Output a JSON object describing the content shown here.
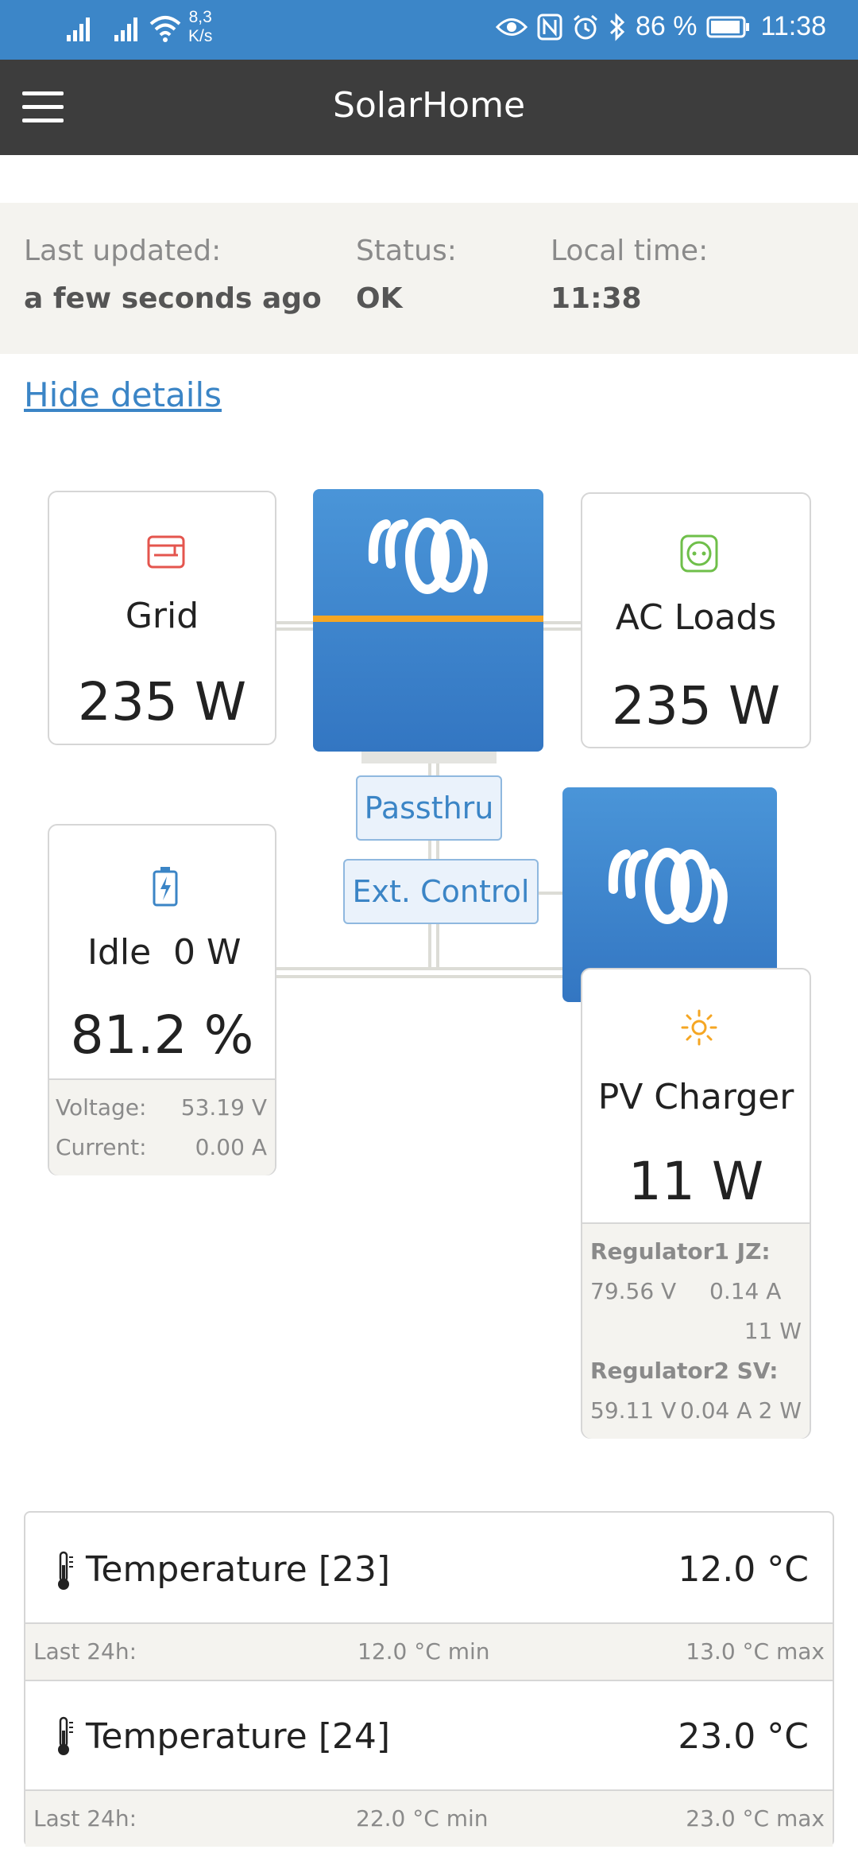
{
  "status_bar": {
    "net_speed_value": "8,3",
    "net_speed_unit": "K/s",
    "battery": "86 %",
    "time": "11:38"
  },
  "app_bar": {
    "title": "SolarHome"
  },
  "info": {
    "last_updated_label": "Last updated:",
    "last_updated_value": "a few seconds ago",
    "status_label": "Status:",
    "status_value": "OK",
    "local_time_label": "Local time:",
    "local_time_value": "11:38"
  },
  "hide_details": "Hide details",
  "grid": {
    "label": "Grid",
    "value": "235 W",
    "icon": "grid-icon"
  },
  "ac_loads": {
    "label": "AC Loads",
    "value": "235 W",
    "icon": "socket-icon"
  },
  "battery": {
    "state": "Idle",
    "power": "0 W",
    "soc": "81.2 %",
    "voltage_label": "Voltage:",
    "voltage_value": "53.19 V",
    "current_label": "Current:",
    "current_value": "0.00 A",
    "icon": "battery-charging-icon"
  },
  "tags": {
    "passthru": "Passthru",
    "ext_control": "Ext. Control"
  },
  "pv_charger": {
    "label": "PV Charger",
    "value": "11 W",
    "icon": "sun-icon",
    "regulators": [
      {
        "name": "Regulator1 JZ:",
        "voltage": "79.56 V",
        "current": "0.14 A",
        "power": "11 W"
      },
      {
        "name": "Regulator2 SV:",
        "voltage": "59.11 V",
        "current": "0.04 A",
        "power": "2 W"
      }
    ]
  },
  "temperatures": [
    {
      "name": "Temperature [23]",
      "value": "12.0 °C",
      "last24_label": "Last 24h:",
      "min": "12.0 °C min",
      "max": "13.0 °C max"
    },
    {
      "name": "Temperature [24]",
      "value": "23.0 °C",
      "last24_label": "Last 24h:",
      "min": "22.0 °C min",
      "max": "23.0 °C max"
    }
  ],
  "colors": {
    "status_bar": "#3c86c8",
    "app_bar": "#3d3d3d",
    "accent": "#3b85c6",
    "orange": "#f5a623"
  }
}
